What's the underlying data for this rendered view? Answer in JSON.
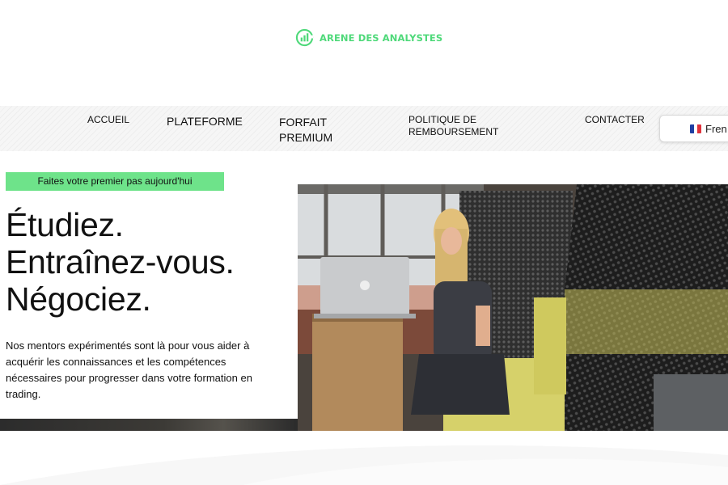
{
  "brand": {
    "name": "ARENE DES ANALYSTES",
    "logo_icon": "chart-circle-icon",
    "accent_color": "#4fd97a"
  },
  "nav": {
    "items": [
      {
        "label": "ACCUEIL"
      },
      {
        "label": "PLATEFORME"
      },
      {
        "label": "FORFAIT PREMIUM"
      },
      {
        "label": "POLITIQUE DE REMBOURSEMENT"
      },
      {
        "label": "CONTACTER"
      }
    ],
    "language": {
      "label": "Fren",
      "flag_icon": "france-flag-icon"
    }
  },
  "hero": {
    "badge": "Faites votre premier pas aujourd'hui",
    "badge_color": "#6ee38a",
    "headline": [
      "Étudiez.",
      "Entraînez-vous.",
      "Négociez."
    ],
    "description": "Nos mentors expérimentés sont là pour vous aider à acquérir les connaissances et les compétences nécessaires pour progresser dans votre formation en trading.",
    "image_icon": "woman-with-laptop-photo"
  }
}
